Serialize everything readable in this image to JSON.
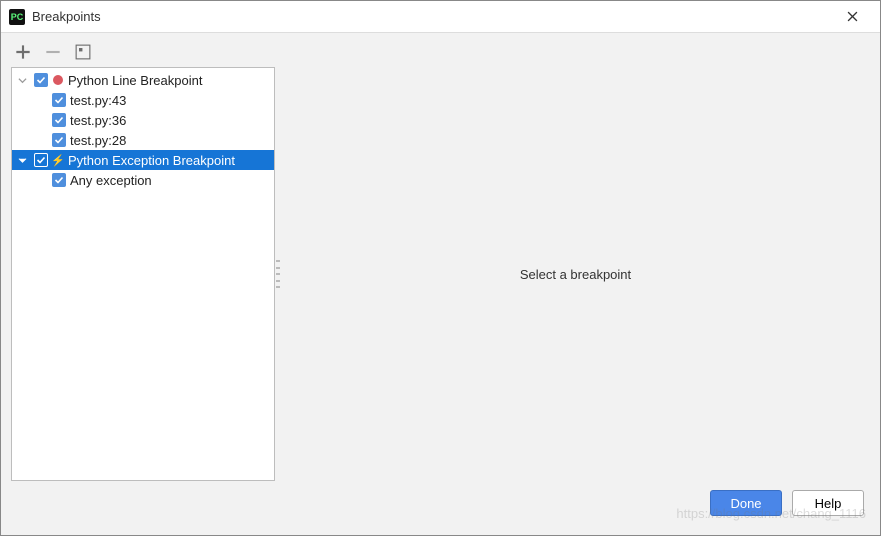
{
  "window": {
    "title": "Breakpoints"
  },
  "toolbar": {
    "add": "+",
    "remove": "−"
  },
  "tree": {
    "groups": [
      {
        "label": "Python Line Breakpoint",
        "expanded": true,
        "checked": true,
        "icon": "circle",
        "selected": false,
        "items": [
          {
            "label": "test.py:43",
            "checked": true
          },
          {
            "label": "test.py:36",
            "checked": true
          },
          {
            "label": "test.py:28",
            "checked": true
          }
        ]
      },
      {
        "label": "Python Exception Breakpoint",
        "expanded": true,
        "checked": true,
        "icon": "lightning",
        "selected": true,
        "items": [
          {
            "label": "Any exception",
            "checked": true
          }
        ]
      }
    ]
  },
  "detail": {
    "placeholder": "Select a breakpoint"
  },
  "buttons": {
    "done": "Done",
    "help": "Help"
  },
  "watermark": "https://blog.csdn.net/chang_1116"
}
